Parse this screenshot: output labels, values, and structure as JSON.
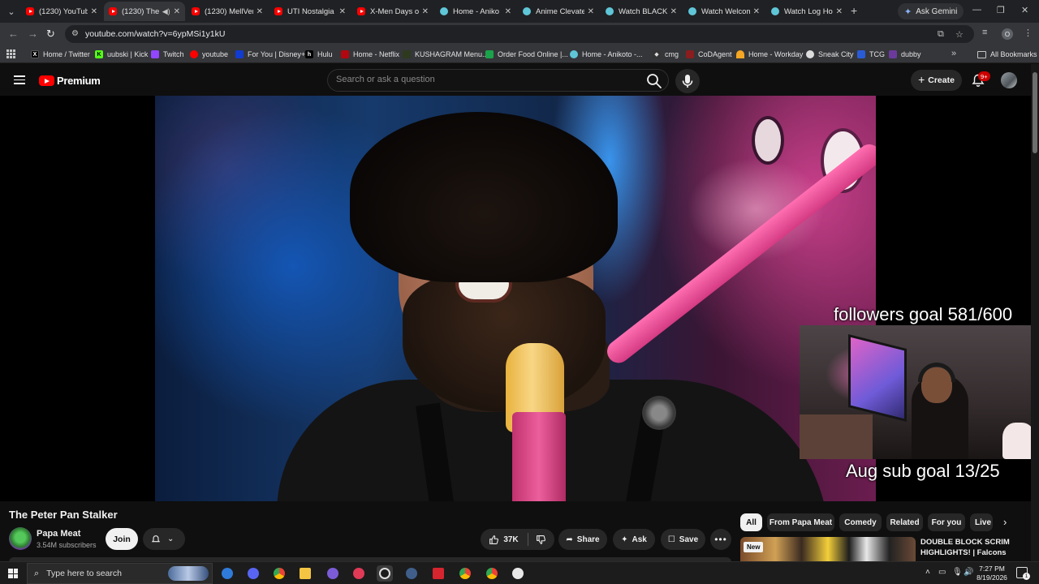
{
  "browser": {
    "tabs": [
      {
        "label": "(1230) YouTube",
        "icon": "youtube-favicon"
      },
      {
        "label": "(1230) The",
        "icon": "youtube-favicon",
        "active": true,
        "audio": true
      },
      {
        "label": "(1230) MellVer",
        "icon": "youtube-favicon"
      },
      {
        "label": "UTI Nostalgia",
        "icon": "youtube-favicon"
      },
      {
        "label": "X-Men Days of",
        "icon": "youtube-favicon"
      },
      {
        "label": "Home - Aniko",
        "icon": "anikoto-favicon"
      },
      {
        "label": "Anime Clevate",
        "icon": "anikoto-favicon"
      },
      {
        "label": "Watch BLACK",
        "icon": "anikoto-favicon"
      },
      {
        "label": "Watch Welcom",
        "icon": "anikoto-favicon"
      },
      {
        "label": "Watch Log Ho",
        "icon": "anikoto-favicon"
      }
    ],
    "ask_gemini_label": "Ask Gemini",
    "url": "youtube.com/watch?v=6ypMSi1y1kU",
    "profile_initial": "O",
    "bookmarks": [
      {
        "label": "Home / Twitter",
        "icon": "x-icon"
      },
      {
        "label": "uubski | Kick",
        "icon": "kick-icon"
      },
      {
        "label": "Twitch",
        "icon": "twitch-icon"
      },
      {
        "label": "youtube",
        "icon": "youtube-icon"
      },
      {
        "label": "For You | Disney+",
        "icon": "disney-icon"
      },
      {
        "label": "Hulu",
        "icon": "hulu-icon"
      },
      {
        "label": "Home - Netflix",
        "icon": "netflix-icon"
      },
      {
        "label": "KUSHAGRAM Menu...",
        "icon": "kushagram-icon"
      },
      {
        "label": "Order Food Online |...",
        "icon": "food-icon"
      },
      {
        "label": "Home - Anikoto -...",
        "icon": "anikoto-icon"
      },
      {
        "label": "cmg",
        "icon": "cmg-icon"
      },
      {
        "label": "CoDAgent",
        "icon": "codagent-icon"
      },
      {
        "label": "Home - Workday",
        "icon": "workday-icon"
      },
      {
        "label": "Sneak City",
        "icon": "sneakcity-icon"
      },
      {
        "label": "TCG",
        "icon": "tcg-icon"
      },
      {
        "label": "dubby",
        "icon": "dubby-icon"
      }
    ],
    "all_bookmarks_label": "All Bookmarks"
  },
  "youtube": {
    "logo_text": "Premium",
    "search_placeholder": "Search or ask a question",
    "create_label": "Create",
    "notification_count": "9+",
    "video": {
      "title": "The Peter Pan Stalker",
      "overlay_followers": "followers goal 581/600",
      "overlay_subs": "Aug sub goal 13/25"
    },
    "channel": {
      "name": "Papa Meat",
      "subscribers": "3.54M subscribers",
      "join_label": "Join"
    },
    "actions": {
      "likes": "37K",
      "share": "Share",
      "ask": "Ask",
      "save": "Save"
    },
    "chips": [
      "All",
      "From Papa Meat",
      "Comedy",
      "Related",
      "For you",
      "Live"
    ],
    "recommendation": {
      "badge": "New",
      "title": "DOUBLE BLOCK SCRIM HIGHLIGHTS! | Falcons"
    }
  },
  "taskbar": {
    "search_placeholder": "Type here to search",
    "time": "7:27 PM",
    "date": "8/19/2026",
    "notification_count": "1"
  }
}
